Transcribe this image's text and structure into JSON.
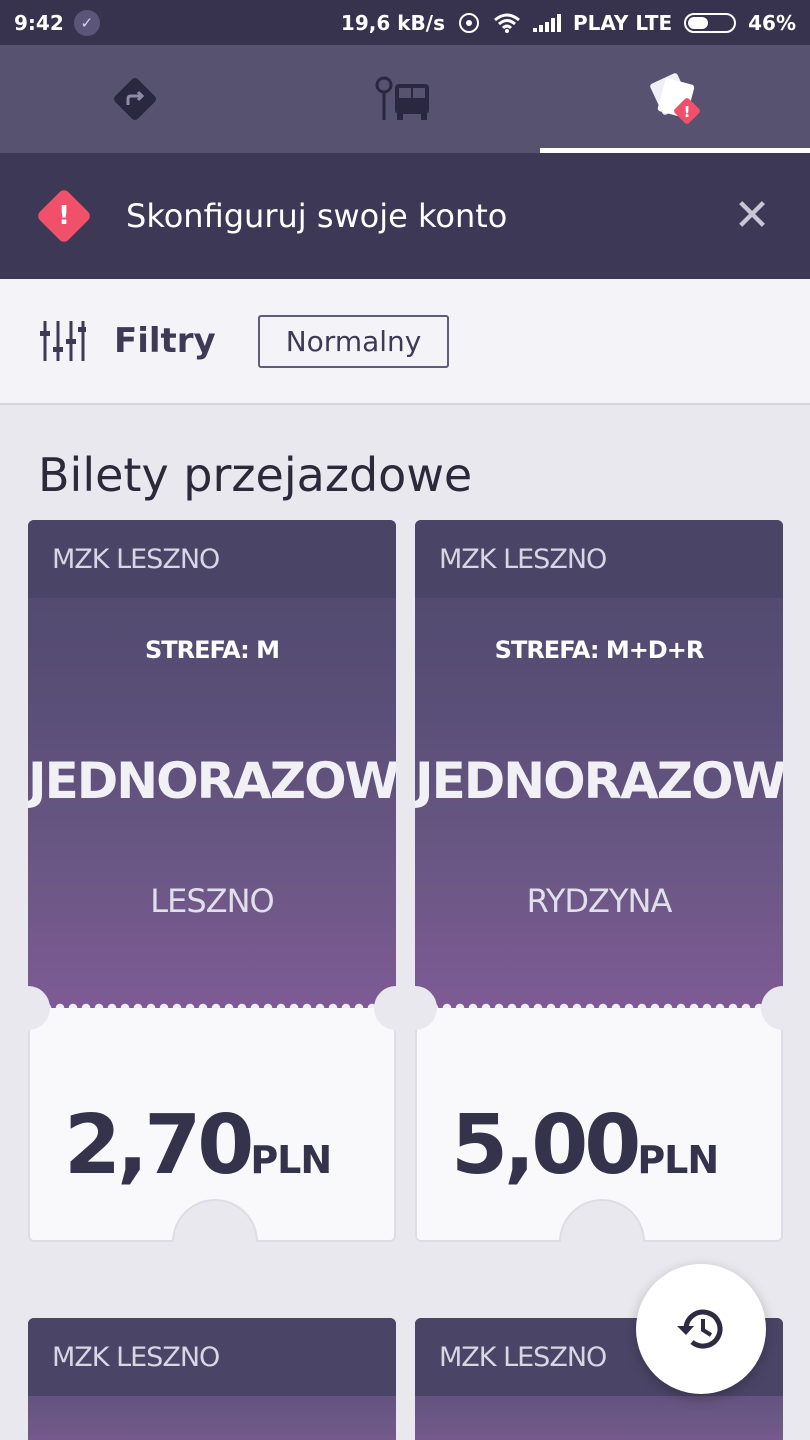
{
  "status_bar": {
    "time": "9:42",
    "speed": "19,6 kB/s",
    "carrier": "PLAY LTE",
    "battery": "46%",
    "battery_level": 0.46
  },
  "tabs": [
    {
      "name": "directions-icon"
    },
    {
      "name": "bus-stop-icon"
    },
    {
      "name": "tickets-alert-icon",
      "active": true
    }
  ],
  "notice": {
    "text": "Skonfiguruj swoje konto",
    "accent": "#f0506a"
  },
  "filters": {
    "label": "Filtry",
    "chip": "Normalny"
  },
  "section_title": "Bilety przejazdowe",
  "tickets": [
    {
      "operator": "MZK LESZNO",
      "zone": "STREFA: M",
      "type": "JEDNORAZOWY",
      "city": "LESZNO",
      "price": "2,70",
      "currency": "PLN"
    },
    {
      "operator": "MZK LESZNO",
      "zone": "STREFA: M+D+R",
      "type": "JEDNORAZOWY",
      "city": "RYDZYNA",
      "price": "5,00",
      "currency": "PLN"
    },
    {
      "operator": "MZK LESZNO"
    },
    {
      "operator": "MZK LESZNO"
    }
  ],
  "fab": {
    "icon": "history-icon"
  }
}
